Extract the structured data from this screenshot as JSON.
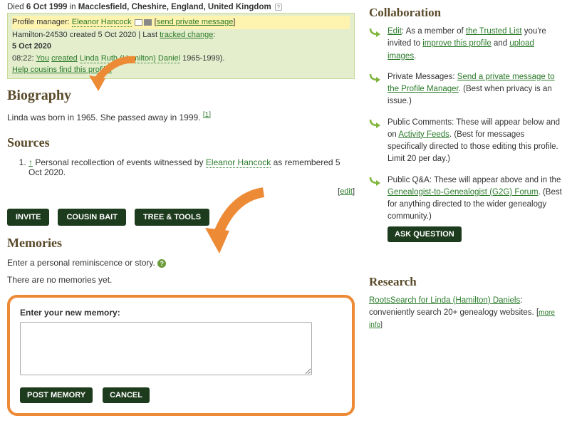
{
  "death": {
    "prefix": "Died",
    "date": "6 Oct 1999",
    "in": "in",
    "place": "Macclesfield, Cheshire, England, United Kingdom"
  },
  "infobox": {
    "pm_label": "Profile manager:",
    "pm_name": "Eleanor Hancock",
    "pm_send": "send private message",
    "created_prefix": "Hamilton-24530 created 5 Oct 2020 | Last",
    "tracked": "tracked change",
    "date_bold": "5 Oct 2020",
    "event_time": "08:22:",
    "event_you": "You",
    "event_created": "created",
    "event_name": "Linda Ruth (Hamilton) Daniel",
    "event_years": "1965-1999).",
    "help_link": "Help cousins find this profile."
  },
  "bio": {
    "heading": "Biography",
    "text": "Linda was born in 1965. She passed away in 1999.",
    "ref": "[1]"
  },
  "sources": {
    "heading": "Sources",
    "item_caret": "↑",
    "item_prefix": "Personal recollection of events witnessed by",
    "item_name": "Eleanor Hancock",
    "item_suffix": "as remembered 5 Oct 2020.",
    "edit": "edit"
  },
  "buttons": {
    "invite": "INVITE",
    "cousin": "COUSIN BAIT",
    "tree": "TREE & TOOLS"
  },
  "memories": {
    "heading": "Memories",
    "prompt": "Enter a personal reminiscence or story.",
    "none": "There are no memories yet.",
    "form_label": "Enter your new memory:",
    "post": "POST MEMORY",
    "cancel": "CANCEL"
  },
  "collab": {
    "heading": "Collaboration",
    "items": [
      {
        "lead_link": "Edit",
        "text1": ": As a member of ",
        "link2": "the Trusted List",
        "text2": " you're invited to ",
        "link3": "improve this profile",
        "text3": " and ",
        "link4": "upload images",
        "text4": "."
      },
      {
        "text1": "Private Messages: ",
        "link2": "Send a private message to the Profile Manager",
        "text2": ". (Best when privacy is an issue.)"
      },
      {
        "text1": "Public Comments: These will appear below and on ",
        "link2": "Activity Feeds",
        "text2": ". (Best for messages specifically directed to those editing this profile. Limit 20 per day.)"
      },
      {
        "text1": "Public Q&A: These will appear above and in the ",
        "link2": "Genealogist-to-Genealogist (G2G) Forum",
        "text2": ". (Best for anything directed to the wider genealogy community.)",
        "button": "ASK QUESTION"
      }
    ]
  },
  "research": {
    "heading": "Research",
    "link": "RootsSearch for Linda (Hamilton) Daniels",
    "text": ": conveniently search 20+ genealogy websites. [",
    "more": "more info",
    "close": "]"
  }
}
